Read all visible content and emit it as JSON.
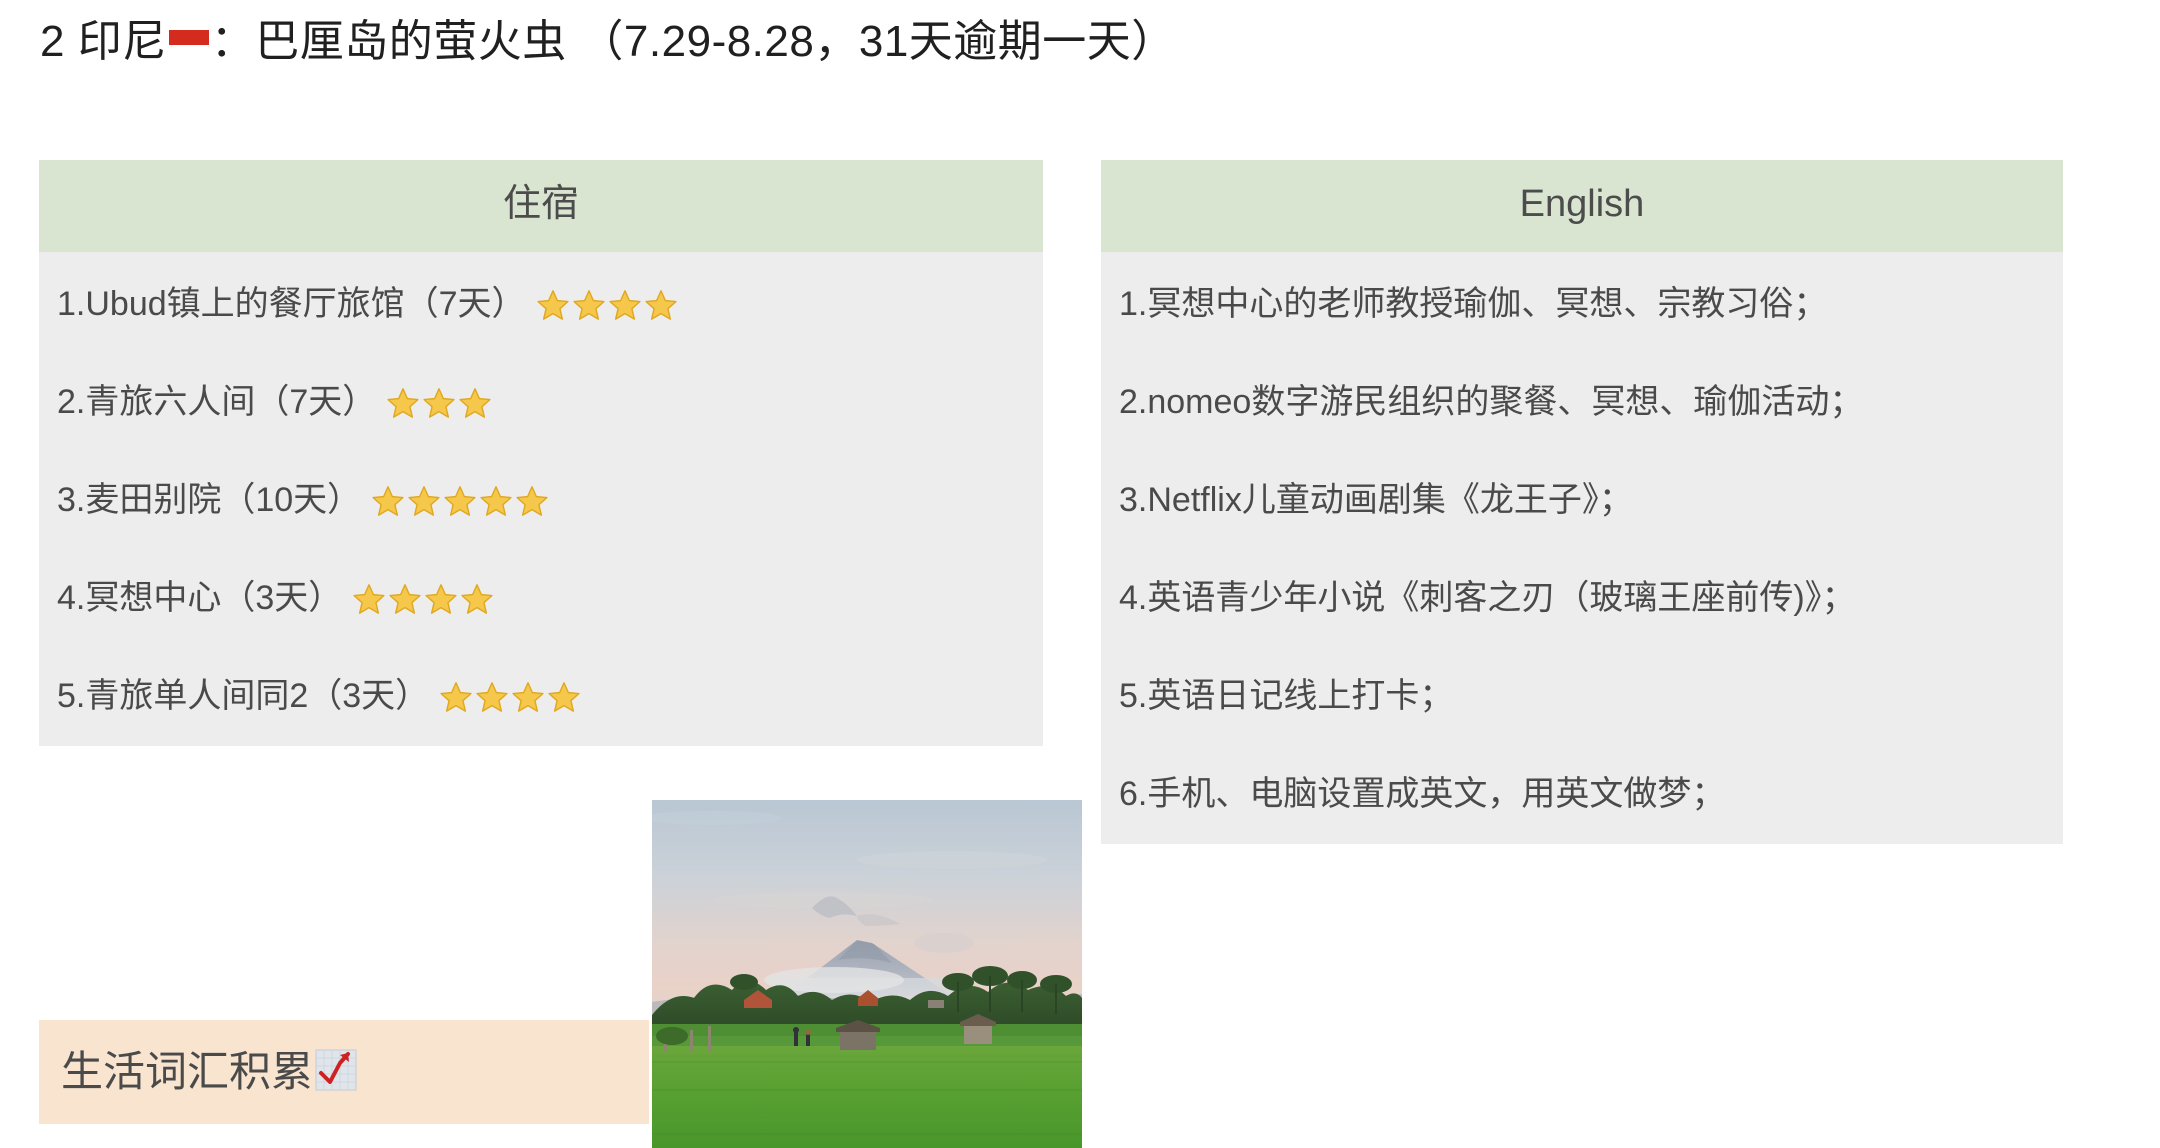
{
  "title": {
    "prefix": "2 印尼",
    "flag_icon": "indonesia-flag-icon",
    "suffix": "：巴厘岛的萤火虫 （7.29-8.28，31天逾期一天）",
    "full": "2 印尼🇮🇩：巴厘岛的萤火虫 （7.29-8.28，31天逾期一天）"
  },
  "colors": {
    "header_green": "#d9e5d0",
    "body_gray": "#ededed",
    "vocab_peach": "#f8e4cf",
    "text_gray": "#4a4a4a",
    "star_gold": "#f5c74a"
  },
  "tables": {
    "accommodation": {
      "header": "住宿",
      "rows": [
        {
          "text": "1.Ubud镇上的餐厅旅馆（7天）",
          "stars": 4
        },
        {
          "text": "2.青旅六人间（7天）",
          "stars": 3
        },
        {
          "text": "3.麦田别院（10天）",
          "stars": 5
        },
        {
          "text": "4.冥想中心（3天）",
          "stars": 4
        },
        {
          "text": "5.青旅单人间同2（3天）",
          "stars": 4
        }
      ]
    },
    "english": {
      "header": "English",
      "rows": [
        {
          "text": "1.冥想中心的老师教授瑜伽、冥想、宗教习俗；"
        },
        {
          "text": "2.nomeo数字游民组织的聚餐、冥想、瑜伽活动；"
        },
        {
          "text": "3.Netflix儿童动画剧集《龙王子》；"
        },
        {
          "text": "4.英语青少年小说《刺客之刃（玻璃王座前传)》；"
        },
        {
          "text": "5.英语日记线上打卡；"
        },
        {
          "text": "6.手机、电脑设置成英文，用英文做梦；"
        }
      ]
    }
  },
  "vocab_box": {
    "label": "生活词汇积累",
    "icon": "chart-increasing-icon"
  },
  "photo": {
    "name": "bali-rice-field-photo",
    "alt": "巴厘岛稻田与远山黄昏照片"
  }
}
